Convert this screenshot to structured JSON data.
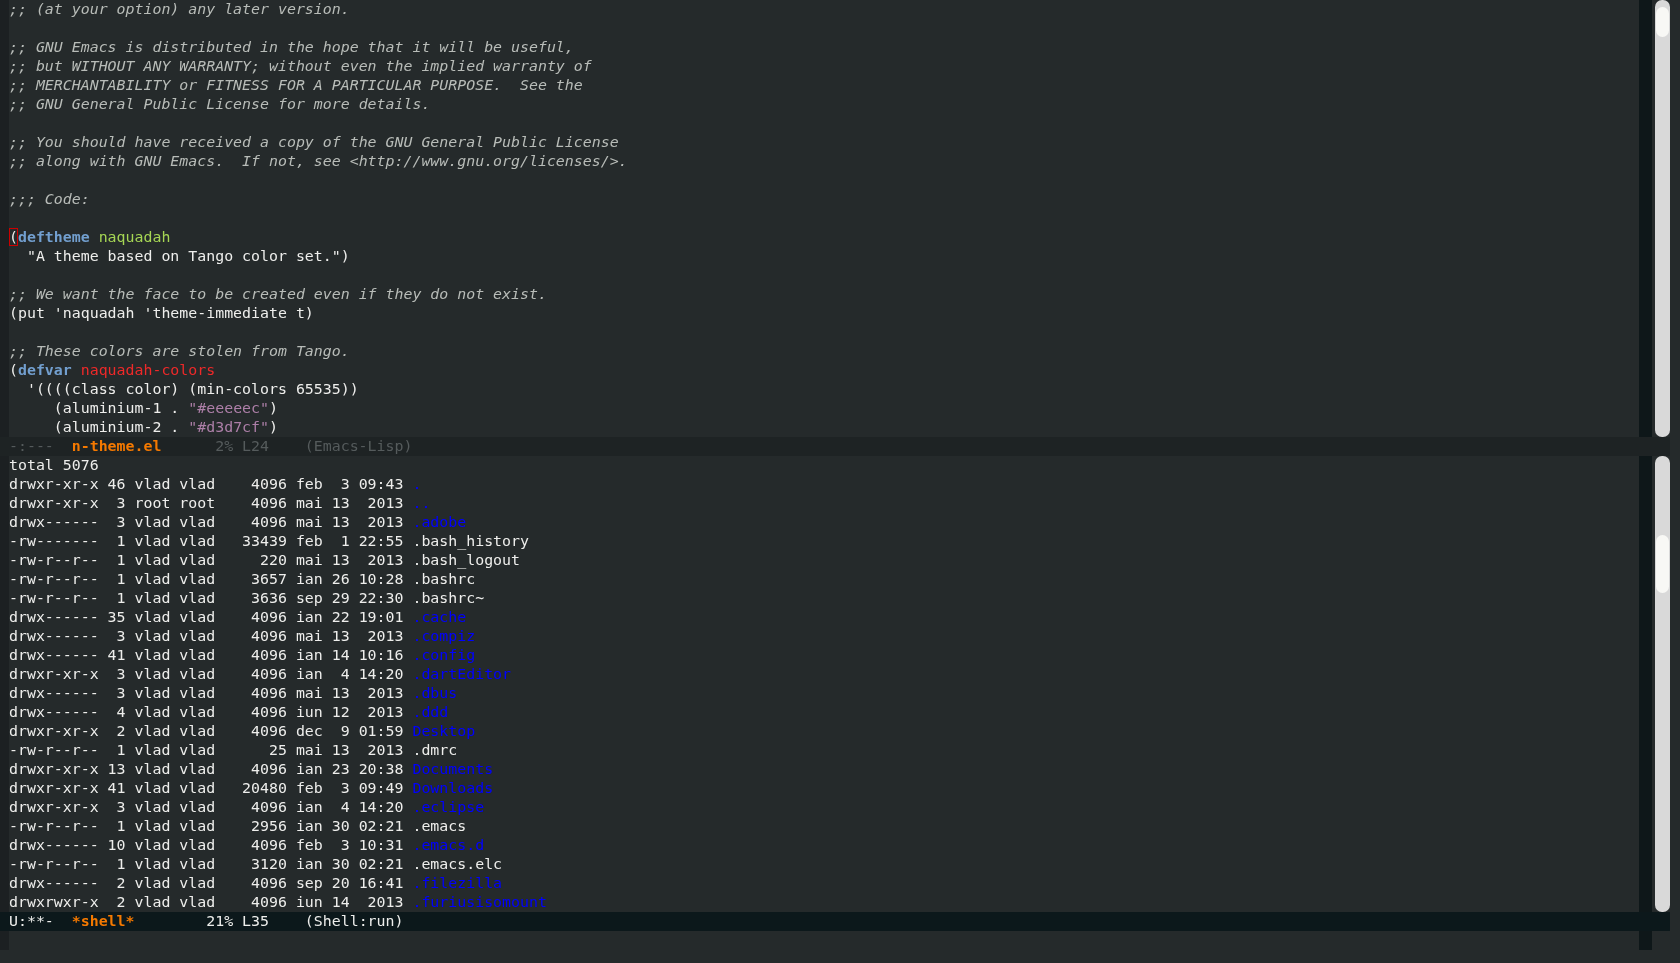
{
  "code_buffer": {
    "lines": [
      {
        "kind": "code",
        "segments": [
          {
            "kind": "comment",
            "text": ";; (at your option) any later version."
          }
        ]
      },
      {
        "kind": "blank"
      },
      {
        "kind": "code",
        "segments": [
          {
            "kind": "comment",
            "text": ";; GNU Emacs is distributed in the hope that it will be useful,"
          }
        ]
      },
      {
        "kind": "code",
        "segments": [
          {
            "kind": "comment",
            "text": ";; but WITHOUT ANY WARRANTY; without even the implied warranty of"
          }
        ]
      },
      {
        "kind": "code",
        "segments": [
          {
            "kind": "comment",
            "text": ";; MERCHANTABILITY or FITNESS FOR A PARTICULAR PURPOSE.  See the"
          }
        ]
      },
      {
        "kind": "code",
        "segments": [
          {
            "kind": "comment",
            "text": ";; GNU General Public License for more details."
          }
        ]
      },
      {
        "kind": "blank"
      },
      {
        "kind": "code",
        "segments": [
          {
            "kind": "comment",
            "text": ";; You should have received a copy of the GNU General Public License"
          }
        ]
      },
      {
        "kind": "code",
        "segments": [
          {
            "kind": "comment",
            "text": ";; along with GNU Emacs.  If not, see <http://www.gnu.org/licenses/>."
          }
        ]
      },
      {
        "kind": "blank"
      },
      {
        "kind": "code",
        "segments": [
          {
            "kind": "comment",
            "text": ";;; Code:"
          }
        ]
      },
      {
        "kind": "blank"
      },
      {
        "kind": "code",
        "segments": [
          {
            "kind": "cursor",
            "text": "("
          },
          {
            "kind": "keyword",
            "text": "deftheme"
          },
          {
            "kind": "function",
            "text": "naquadah"
          }
        ]
      },
      {
        "kind": "code",
        "segments": [
          {
            "kind": "plain",
            "text": "  \"A theme based on Tango color set.\")"
          }
        ]
      },
      {
        "kind": "blank"
      },
      {
        "kind": "code",
        "segments": [
          {
            "kind": "comment",
            "text": ";; We want the face to be created even if they do not exist."
          }
        ]
      },
      {
        "kind": "code",
        "segments": [
          {
            "kind": "plain",
            "text": "(put 'naquadah 'theme-immediate t)"
          }
        ]
      },
      {
        "kind": "blank"
      },
      {
        "kind": "code",
        "segments": [
          {
            "kind": "comment",
            "text": ";; These colors are stolen from Tango."
          }
        ]
      },
      {
        "kind": "code",
        "segments": [
          {
            "kind": "plain",
            "text": "("
          },
          {
            "kind": "keyword",
            "text": "defvar"
          },
          {
            "kind": "variable",
            "text": "naquadah-colors"
          }
        ]
      },
      {
        "kind": "code",
        "segments": [
          {
            "kind": "plain",
            "text": "  '((((class color) (min-colors 65535))"
          }
        ]
      },
      {
        "kind": "code",
        "segments": [
          {
            "kind": "plain",
            "text": "     (aluminium-1 . "
          },
          {
            "kind": "string",
            "text": "\"#eeeeec\""
          },
          {
            "kind": "plain",
            "text": ")"
          }
        ]
      },
      {
        "kind": "code",
        "segments": [
          {
            "kind": "plain",
            "text": "     (aluminium-2 . "
          },
          {
            "kind": "string",
            "text": "\"#d3d7cf\""
          },
          {
            "kind": "plain",
            "text": ")"
          }
        ]
      }
    ]
  },
  "code_mode_line": {
    "active": false,
    "status": "-:---",
    "buffer": "n-theme.el",
    "position": "2% L24",
    "mode": "(Emacs-Lisp)"
  },
  "shell_buffer": {
    "total": "total 5076",
    "rows": [
      {
        "info": "drwxr-xr-x 46 vlad vlad    4096 feb  3 09:43",
        "name": ".",
        "directory": true
      },
      {
        "info": "drwxr-xr-x  3 root root    4096 mai 13  2013",
        "name": "..",
        "directory": true
      },
      {
        "info": "drwx------  3 vlad vlad    4096 mai 13  2013",
        "name": ".adobe",
        "directory": true
      },
      {
        "info": "-rw-------  1 vlad vlad   33439 feb  1 22:55",
        "name": ".bash_history",
        "directory": false
      },
      {
        "info": "-rw-r--r--  1 vlad vlad     220 mai 13  2013",
        "name": ".bash_logout",
        "directory": false
      },
      {
        "info": "-rw-r--r--  1 vlad vlad    3657 ian 26 10:28",
        "name": ".bashrc",
        "directory": false
      },
      {
        "info": "-rw-r--r--  1 vlad vlad    3636 sep 29 22:30",
        "name": ".bashrc~",
        "directory": false
      },
      {
        "info": "drwx------ 35 vlad vlad    4096 ian 22 19:01",
        "name": ".cache",
        "directory": true
      },
      {
        "info": "drwx------  3 vlad vlad    4096 mai 13  2013",
        "name": ".compiz",
        "directory": true
      },
      {
        "info": "drwx------ 41 vlad vlad    4096 ian 14 10:16",
        "name": ".config",
        "directory": true
      },
      {
        "info": "drwxr-xr-x  3 vlad vlad    4096 ian  4 14:20",
        "name": ".dartEditor",
        "directory": true
      },
      {
        "info": "drwx------  3 vlad vlad    4096 mai 13  2013",
        "name": ".dbus",
        "directory": true
      },
      {
        "info": "drwx------  4 vlad vlad    4096 iun 12  2013",
        "name": ".ddd",
        "directory": true
      },
      {
        "info": "drwxr-xr-x  2 vlad vlad    4096 dec  9 01:59",
        "name": "Desktop",
        "directory": true
      },
      {
        "info": "-rw-r--r--  1 vlad vlad      25 mai 13  2013",
        "name": ".dmrc",
        "directory": false
      },
      {
        "info": "drwxr-xr-x 13 vlad vlad    4096 ian 23 20:38",
        "name": "Documents",
        "directory": true
      },
      {
        "info": "drwxr-xr-x 41 vlad vlad   20480 feb  3 09:49",
        "name": "Downloads",
        "directory": true
      },
      {
        "info": "drwxr-xr-x  3 vlad vlad    4096 ian  4 14:20",
        "name": ".eclipse",
        "directory": true
      },
      {
        "info": "-rw-r--r--  1 vlad vlad    2956 ian 30 02:21",
        "name": ".emacs",
        "directory": false
      },
      {
        "info": "drwx------ 10 vlad vlad    4096 feb  3 10:31",
        "name": ".emacs.d",
        "directory": true
      },
      {
        "info": "-rw-r--r--  1 vlad vlad    3120 ian 30 02:21",
        "name": ".emacs.elc",
        "directory": false
      },
      {
        "info": "drwx------  2 vlad vlad    4096 sep 20 16:41",
        "name": ".filezilla",
        "directory": true
      },
      {
        "info": "drwxrwxr-x  2 vlad vlad    4096 iun 14  2013",
        "name": ".furiusisomount",
        "directory": true
      }
    ]
  },
  "shell_mode_line": {
    "active": true,
    "status": "U:**-",
    "buffer": "*shell*",
    "position": "21% L35",
    "mode": "(Shell:run)"
  }
}
